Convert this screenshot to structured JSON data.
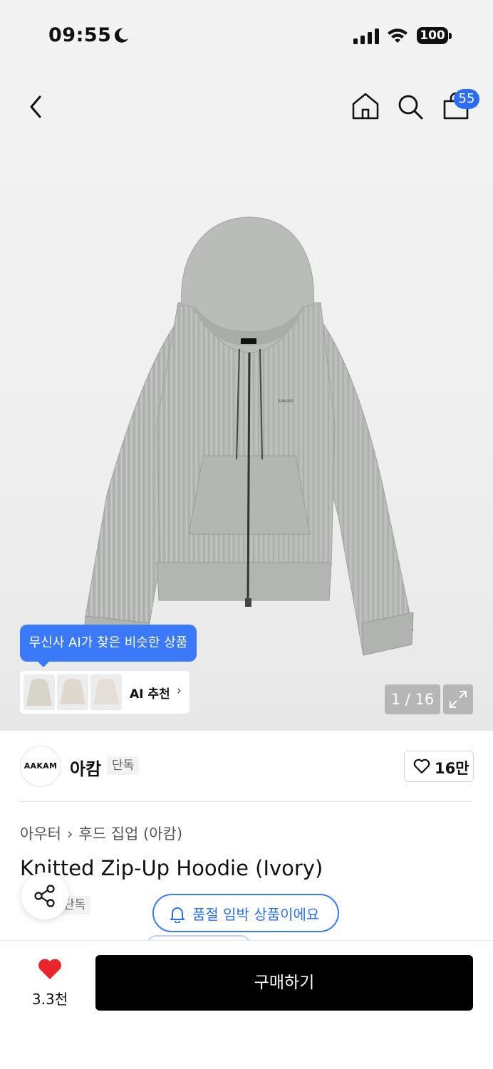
{
  "status_bar": {
    "time": "09:55",
    "battery": "100"
  },
  "header": {
    "cart_count": "55"
  },
  "gallery": {
    "ai_tooltip": "무신사 AI가 찾은 비슷한 상품",
    "ai_label": "AI 추천",
    "counter": "1 / 16"
  },
  "brand": {
    "logo_text": "AAKAM",
    "name": "아캄",
    "tag": "단독",
    "likes": "16만"
  },
  "product": {
    "breadcrumb": [
      "아우터",
      "후드 집업 (아캄)"
    ],
    "title": "Knitted Zip-Up Hoodie (Ivory)",
    "tag": "단독"
  },
  "alert_pill": "품절 임박 상품이에요",
  "bottom_bar": {
    "wish_count": "3.3천",
    "buy_label": "구매하기"
  },
  "colors": {
    "accent": "#3a79f7",
    "badge": "#2d6df6",
    "wish_red": "#e8252b"
  }
}
